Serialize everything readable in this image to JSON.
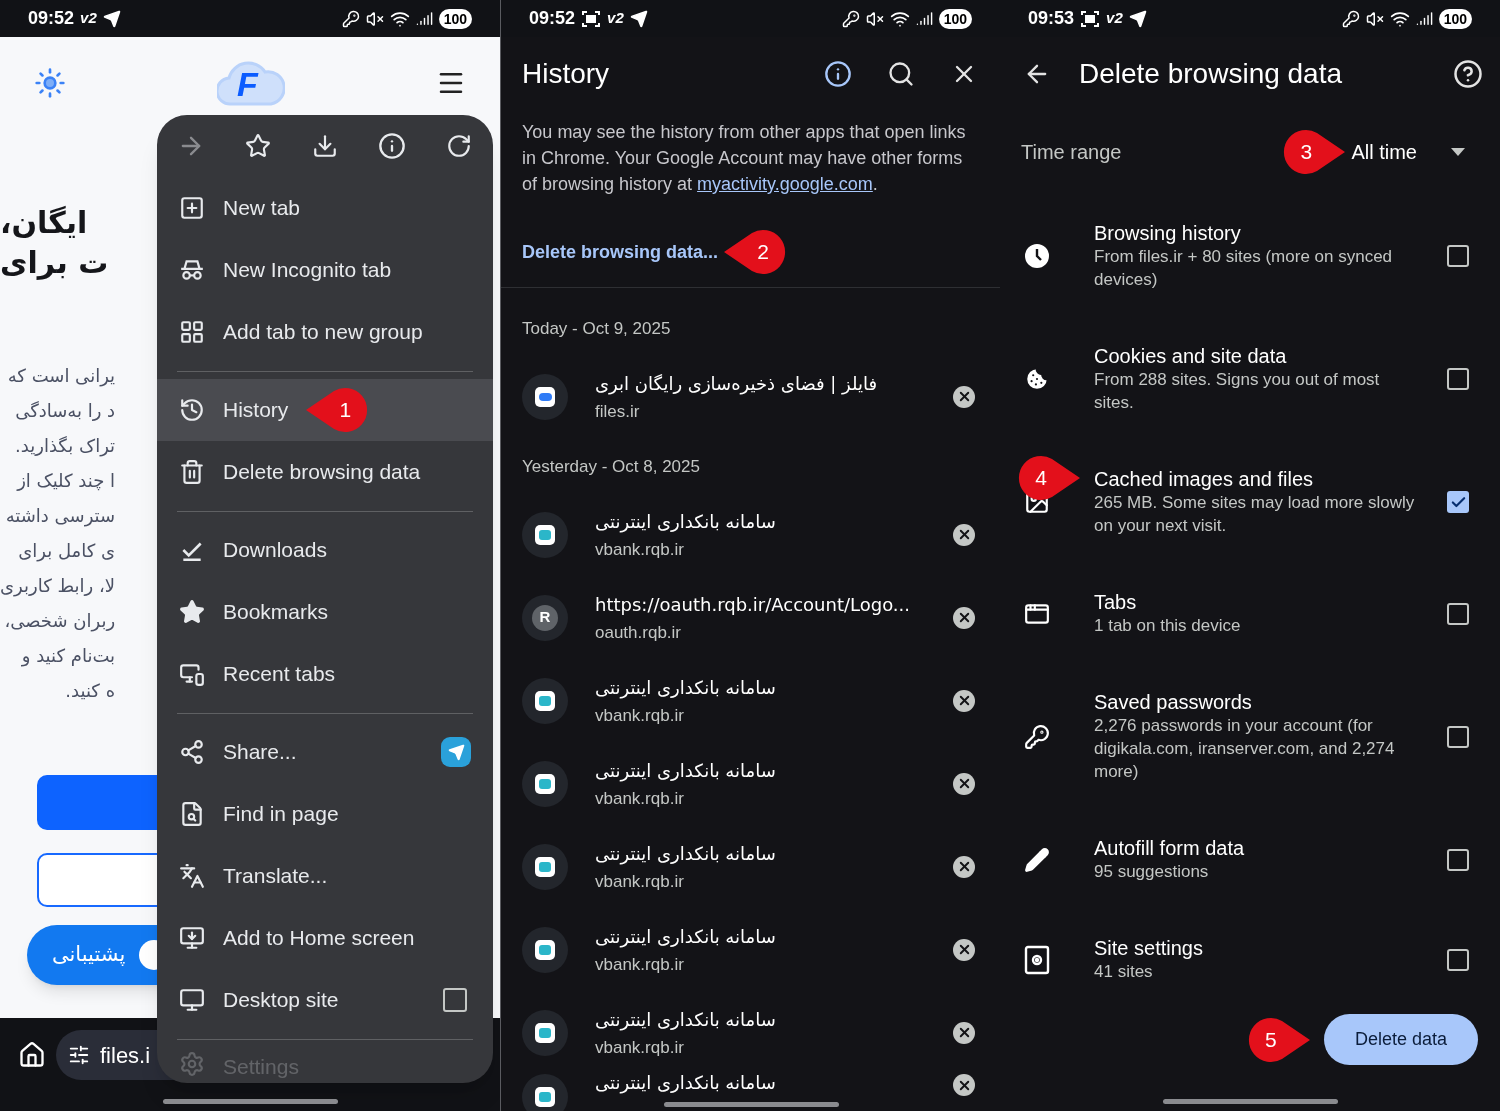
{
  "status_bars": [
    {
      "time": "09:52",
      "recording": false,
      "vpn_label": "v2",
      "battery": "100"
    },
    {
      "time": "09:52",
      "recording": true,
      "vpn_label": "v2",
      "battery": "100"
    },
    {
      "time": "09:53",
      "recording": true,
      "vpn_label": "v2",
      "battery": "100"
    }
  ],
  "web_page": {
    "logo_letter": "F",
    "heading_lines": [
      "ایگان،",
      "ت برای"
    ],
    "paragraph_lines": [
      "یرانی است که",
      "د را به‌سادگی",
      "تراک بگذارید.",
      "ا چند کلیک از",
      "سترسی داشته",
      "ی کامل برای",
      "لا، رابط کاربری",
      "ربران شخصی،",
      "بت‌نام کنید و",
      "ه کنید."
    ],
    "support_button": "پشتیبانی",
    "address": "files.i"
  },
  "menu": {
    "forward_disabled": true,
    "groups": [
      [
        {
          "label": "New tab",
          "selected": false
        },
        {
          "label": "New Incognito tab",
          "selected": false
        },
        {
          "label": "Add tab to new group",
          "selected": false
        }
      ],
      [
        {
          "label": "History",
          "selected": true,
          "marker": "1"
        },
        {
          "label": "Delete browsing data",
          "selected": false
        }
      ],
      [
        {
          "label": "Downloads",
          "selected": false
        },
        {
          "label": "Bookmarks",
          "selected": false
        },
        {
          "label": "Recent tabs",
          "selected": false
        }
      ],
      [
        {
          "label": "Share...",
          "selected": false,
          "kind": "share"
        },
        {
          "label": "Find in page",
          "selected": false
        },
        {
          "label": "Translate...",
          "selected": false
        },
        {
          "label": "Add to Home screen",
          "selected": false
        },
        {
          "label": "Desktop site",
          "selected": false,
          "kind": "checkbox",
          "checked": false
        }
      ],
      [
        {
          "label": "Settings",
          "selected": false,
          "faded": true
        }
      ]
    ]
  },
  "history": {
    "title": "History",
    "info_text": "You may see the history from other apps that open links in Chrome. Your Google Account may have other forms of browsing history at ",
    "info_link": "myactivity.google.com",
    "info_end": ".",
    "delete_link": "Delete browsing data...",
    "delete_marker": "2",
    "days": [
      {
        "date": "Today - Oct 9, 2025",
        "items": [
          {
            "kind": "files",
            "title": "فایلز | فضای ذخیره‌سازی رایگان ابری",
            "domain": "files.ir"
          }
        ]
      },
      {
        "date": "Yesterday - Oct 8, 2025",
        "items": [
          {
            "kind": "bank",
            "title": "سامانه بانکداری اینترنتی",
            "domain": "vbank.rqb.ir"
          },
          {
            "kind": "letter",
            "letter": "R",
            "title": "https://oauth.rqb.ir/Account/Logo...",
            "domain": "oauth.rqb.ir"
          },
          {
            "kind": "bank",
            "title": "سامانه بانکداری اینترنتی",
            "domain": "vbank.rqb.ir"
          },
          {
            "kind": "bank",
            "title": "سامانه بانکداری اینترنتی",
            "domain": "vbank.rqb.ir"
          },
          {
            "kind": "bank",
            "title": "سامانه بانکداری اینترنتی",
            "domain": "vbank.rqb.ir"
          },
          {
            "kind": "bank",
            "title": "سامانه بانکداری اینترنتی",
            "domain": "vbank.rqb.ir"
          },
          {
            "kind": "bank",
            "title": "سامانه بانکداری اینترنتی",
            "domain": "vbank.rqb.ir"
          },
          {
            "kind": "bank",
            "title": "سامانه بانکداری اینترنتی"
          }
        ]
      }
    ]
  },
  "delete_data": {
    "title": "Delete browsing data",
    "time_range_label": "Time range",
    "time_range_value": "All time",
    "time_range_marker": "3",
    "options": [
      {
        "title": "Browsing history",
        "description": "From files.ir + 80 sites (more on synced devices)",
        "checked": false
      },
      {
        "title": "Cookies and site data",
        "description": "From 288 sites. Signs you out of most sites.",
        "checked": false
      },
      {
        "title": "Cached images and files",
        "description": "265 MB. Some sites may load more slowly on your next visit.",
        "checked": true,
        "marker": "4"
      },
      {
        "title": "Tabs",
        "description": "1 tab on this device",
        "checked": false
      },
      {
        "title": "Saved passwords",
        "description": "2,276 passwords in your account (for digikala.com, iranserver.com, and 2,274 more)",
        "checked": false
      },
      {
        "title": "Autofill form data",
        "description": "95 suggestions",
        "checked": false
      },
      {
        "title": "Site settings",
        "description": "41 sites",
        "checked": false
      }
    ],
    "button": "Delete data",
    "button_marker": "5"
  }
}
